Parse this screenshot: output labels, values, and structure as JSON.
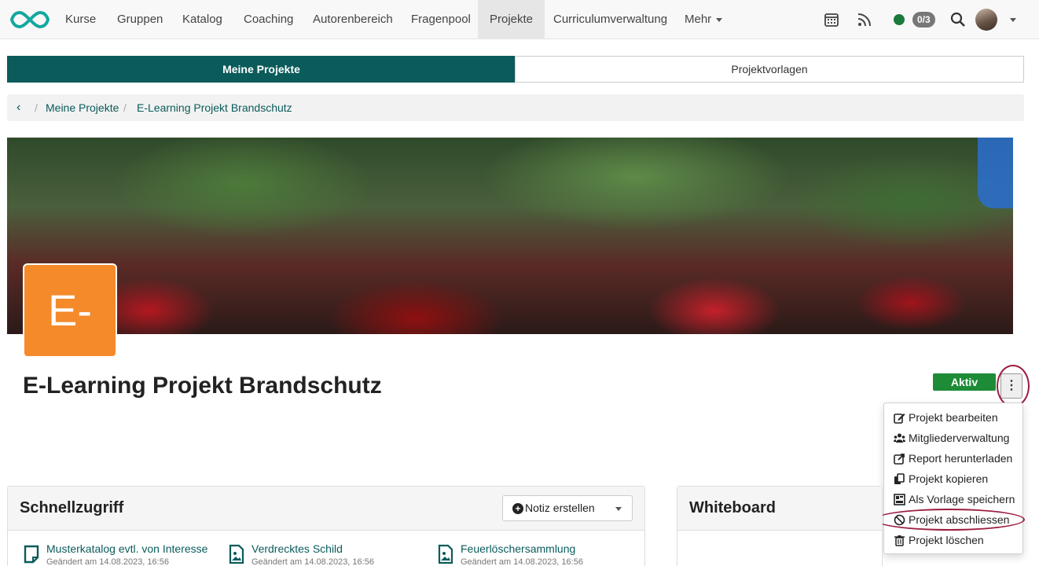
{
  "nav": {
    "items": [
      "Kurse",
      "Gruppen",
      "Katalog",
      "Coaching",
      "Autorenbereich",
      "Fragenpool",
      "Projekte",
      "Curriculumverwaltung",
      "Mehr"
    ],
    "active": "Projekte",
    "badge": "0/3",
    "accent": "#0b5b5b"
  },
  "tabs": {
    "my_projects": "Meine Projekte",
    "templates": "Projektvorlagen"
  },
  "breadcrumb": {
    "sep": "/",
    "items": [
      "Meine Projekte",
      "E-Learning Projekt Brandschutz"
    ]
  },
  "project": {
    "avatar_text": "E-",
    "avatar_color": "#f58a2b",
    "title": "E-Learning Projekt Brandschutz",
    "status": "Aktiv",
    "status_color": "#1e8b36"
  },
  "menu": {
    "items": [
      {
        "label": "Projekt bearbeiten",
        "icon": "edit-icon"
      },
      {
        "label": "Mitgliederverwaltung",
        "icon": "members-icon"
      },
      {
        "label": "Report herunterladen",
        "icon": "export-icon"
      },
      {
        "label": "Projekt kopieren",
        "icon": "copy-icon"
      },
      {
        "label": "Als Vorlage speichern",
        "icon": "template-icon"
      },
      {
        "label": "Projekt abschliessen",
        "icon": "ban-icon"
      },
      {
        "label": "Projekt löschen",
        "icon": "trash-icon"
      }
    ]
  },
  "quick_access": {
    "title": "Schnellzugriff",
    "note_button": "Notiz erstellen",
    "items": [
      {
        "title": "Musterkatalog evtl. von Interesse",
        "changed": "Geändert am 14.08.2023, 16:56",
        "icon": "document-icon"
      },
      {
        "title": "Verdrecktes Schild",
        "changed": "Geändert am 14.08.2023, 16:56",
        "icon": "image-file-icon"
      },
      {
        "title": "Feuerlöschersammlung",
        "changed": "Geändert am 14.08.2023, 16:56",
        "icon": "image-file-icon"
      }
    ]
  },
  "whiteboard": {
    "title": "Whiteboard"
  }
}
